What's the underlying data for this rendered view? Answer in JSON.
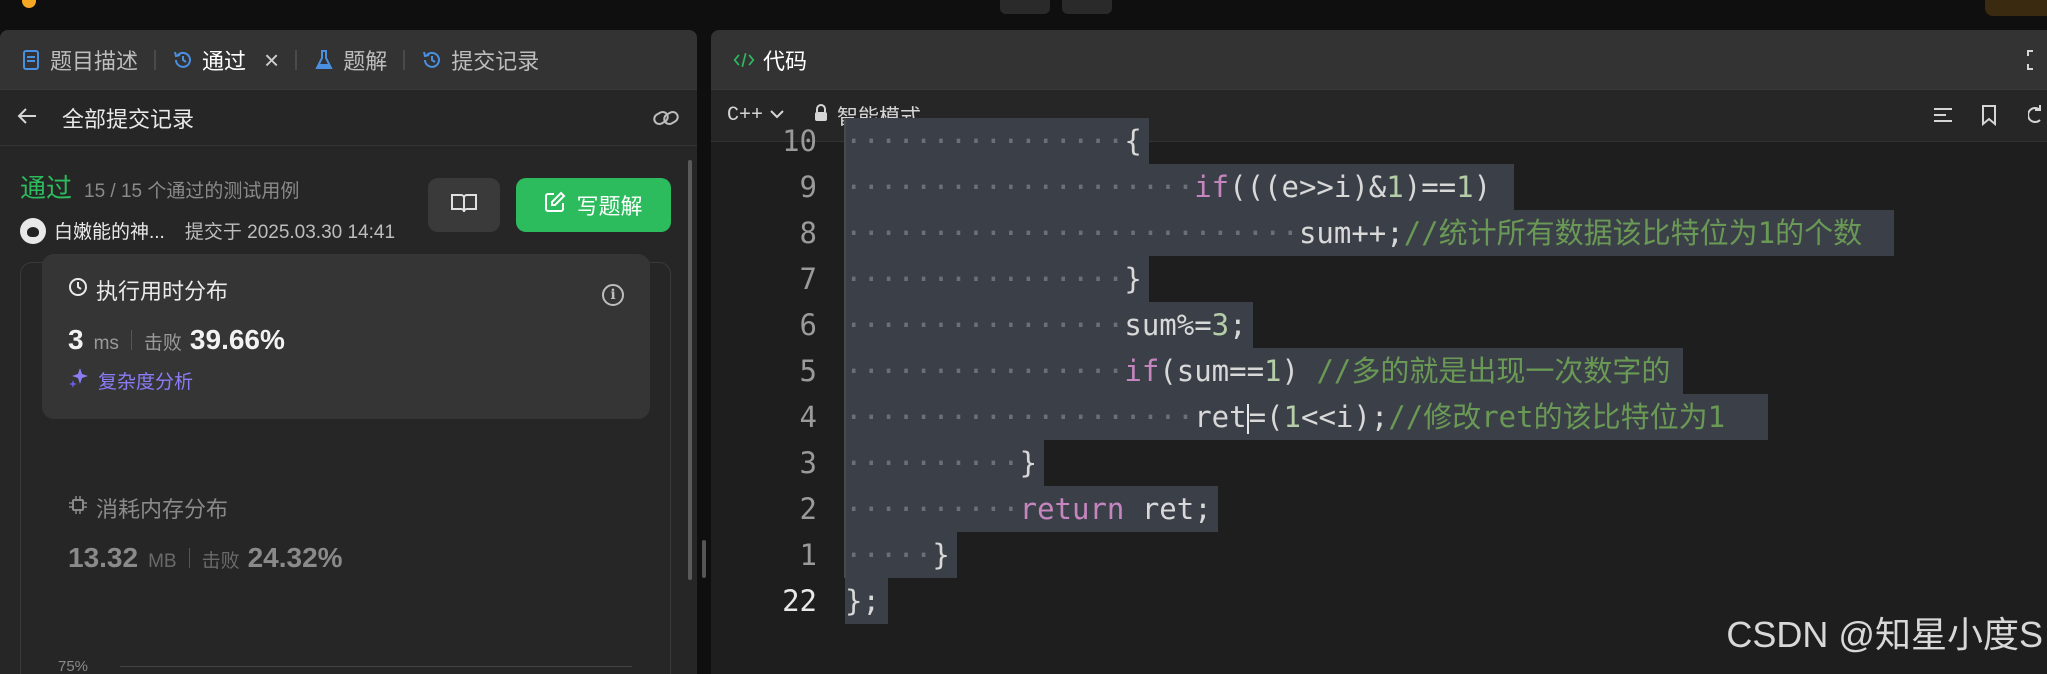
{
  "left_panel": {
    "tabs": [
      {
        "label": "题目描述"
      },
      {
        "label": "通过"
      },
      {
        "label": "题解"
      },
      {
        "label": "提交记录"
      }
    ],
    "close_symbol": "×",
    "back_title": "全部提交记录",
    "status": "通过",
    "test_cases": "15 / 15 个通过的测试用例",
    "submitter": "白嫩能的神...",
    "submitted_at": "提交于 2025.03.30 14:41",
    "write_solution_label": "写题解",
    "runtime": {
      "title": "执行用时分布",
      "value": "3",
      "unit": "ms",
      "beat_label": "击败",
      "percent": "39.66%",
      "complexity_label": "复杂度分析"
    },
    "memory": {
      "title": "消耗内存分布",
      "value": "13.32",
      "unit": "MB",
      "beat_label": "击败",
      "percent": "24.32%"
    },
    "chart_axis_label": "75%"
  },
  "right_panel": {
    "tab_label": "代码",
    "language": "C++",
    "mode": "智能模式",
    "code_lines": [
      {
        "ln": "10",
        "dots": "················",
        "tokens": [
          {
            "t": "{",
            "c": ""
          }
        ]
      },
      {
        "ln": "9",
        "dots": "····················",
        "tokens": [
          {
            "t": "if",
            "c": "kw"
          },
          {
            "t": "(((e>>i)&",
            "c": ""
          },
          {
            "t": "1",
            "c": "num"
          },
          {
            "t": ")==",
            "c": ""
          },
          {
            "t": "1",
            "c": "num"
          },
          {
            "t": ") ",
            "c": ""
          }
        ]
      },
      {
        "ln": "8",
        "dots": "··························",
        "tokens": [
          {
            "t": "sum++;",
            "c": ""
          },
          {
            "t": "//统计所有数据该比特位为1的个数 ",
            "c": "cm"
          }
        ]
      },
      {
        "ln": "7",
        "dots": "················",
        "tokens": [
          {
            "t": "}",
            "c": ""
          }
        ]
      },
      {
        "ln": "6",
        "dots": "················",
        "tokens": [
          {
            "t": "sum%=",
            "c": ""
          },
          {
            "t": "3",
            "c": "num"
          },
          {
            "t": ";",
            "c": ""
          }
        ]
      },
      {
        "ln": "5",
        "dots": "················",
        "tokens": [
          {
            "t": "if",
            "c": "kw"
          },
          {
            "t": "(sum==",
            "c": ""
          },
          {
            "t": "1",
            "c": "num"
          },
          {
            "t": ") ",
            "c": ""
          },
          {
            "t": "//多的就是出现一次数字的",
            "c": "cm"
          }
        ]
      },
      {
        "ln": "4",
        "dots": "····················",
        "tokens": [
          {
            "t": "ret",
            "c": ""
          },
          {
            "t": "|",
            "c": "cursor"
          },
          {
            "t": "=(",
            "c": ""
          },
          {
            "t": "1",
            "c": "num"
          },
          {
            "t": "<<i);",
            "c": ""
          },
          {
            "t": "//修改ret的该比特位为1 ",
            "c": "cm"
          }
        ]
      },
      {
        "ln": "3",
        "dots": "··········",
        "tokens": [
          {
            "t": "}",
            "c": ""
          }
        ]
      },
      {
        "ln": "2",
        "dots": "··········",
        "tokens": [
          {
            "t": "return",
            "c": "kw"
          },
          {
            "t": " ret;",
            "c": ""
          }
        ]
      },
      {
        "ln": "1",
        "dots": "·····",
        "tokens": [
          {
            "t": "}",
            "c": ""
          }
        ]
      },
      {
        "ln": "22",
        "dots": "",
        "tokens": [
          {
            "t": "};",
            "c": ""
          }
        ],
        "current": true
      }
    ],
    "watermark": "CSDN @知星小度S"
  },
  "colors": {
    "accent_green": "#2cbb5d",
    "complexity_purple": "#8b7cf7",
    "keyword": "#c586c0",
    "number": "#b5cea8",
    "comment": "#6a9955",
    "selection": "#3b4048"
  },
  "icons": [
    "description-icon",
    "history-icon",
    "close-icon",
    "flask-icon",
    "history-icon",
    "back-arrow-icon",
    "link-icon",
    "book-icon",
    "edit-icon",
    "clock-icon",
    "info-icon",
    "sparkle-icon",
    "chip-icon",
    "code-icon",
    "chevron-down-icon",
    "lock-icon",
    "list-icon",
    "bookmark-icon",
    "undo-icon",
    "expand-icon"
  ]
}
